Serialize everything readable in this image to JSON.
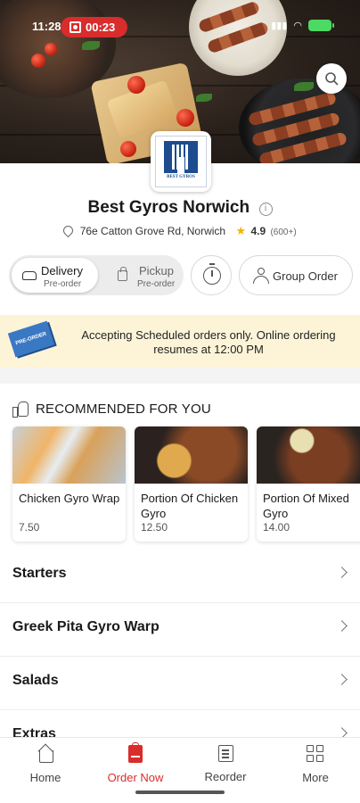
{
  "status_bar": {
    "time": "11:28",
    "recording_time": "00:23"
  },
  "restaurant": {
    "logo_text": "BEST GYROS",
    "name": "Best Gyros Norwich",
    "address": "76e Catton Grove Rd, Norwich",
    "rating": "4.9",
    "rating_count": "(600+)"
  },
  "order_modes": {
    "delivery": {
      "label": "Delivery",
      "sub": "Pre-order"
    },
    "pickup": {
      "label": "Pickup",
      "sub": "Pre-order"
    },
    "group_order_label": "Group Order"
  },
  "banner": {
    "tag": "PRE-ORDER",
    "text": "Accepting Scheduled orders only. Online ordering resumes at 12:00 PM"
  },
  "recommended": {
    "title": "RECOMMENDED FOR YOU",
    "items": [
      {
        "name": "Chicken Gyro Wrap",
        "price": "7.50"
      },
      {
        "name": "Portion Of Chicken Gyro",
        "price": "12.50"
      },
      {
        "name": "Portion Of Mixed Gyro",
        "price": "14.00"
      }
    ]
  },
  "categories": [
    "Starters",
    "Greek Pita Gyro Warp",
    "Salads",
    "Extras"
  ],
  "bottom_nav": {
    "home": "Home",
    "order_now": "Order Now",
    "reorder": "Reorder",
    "more": "More"
  },
  "colors": {
    "accent": "#d92c2c",
    "banner_bg": "#fdf4d8",
    "star": "#f3b400",
    "logo_blue": "#1d4d8f"
  }
}
